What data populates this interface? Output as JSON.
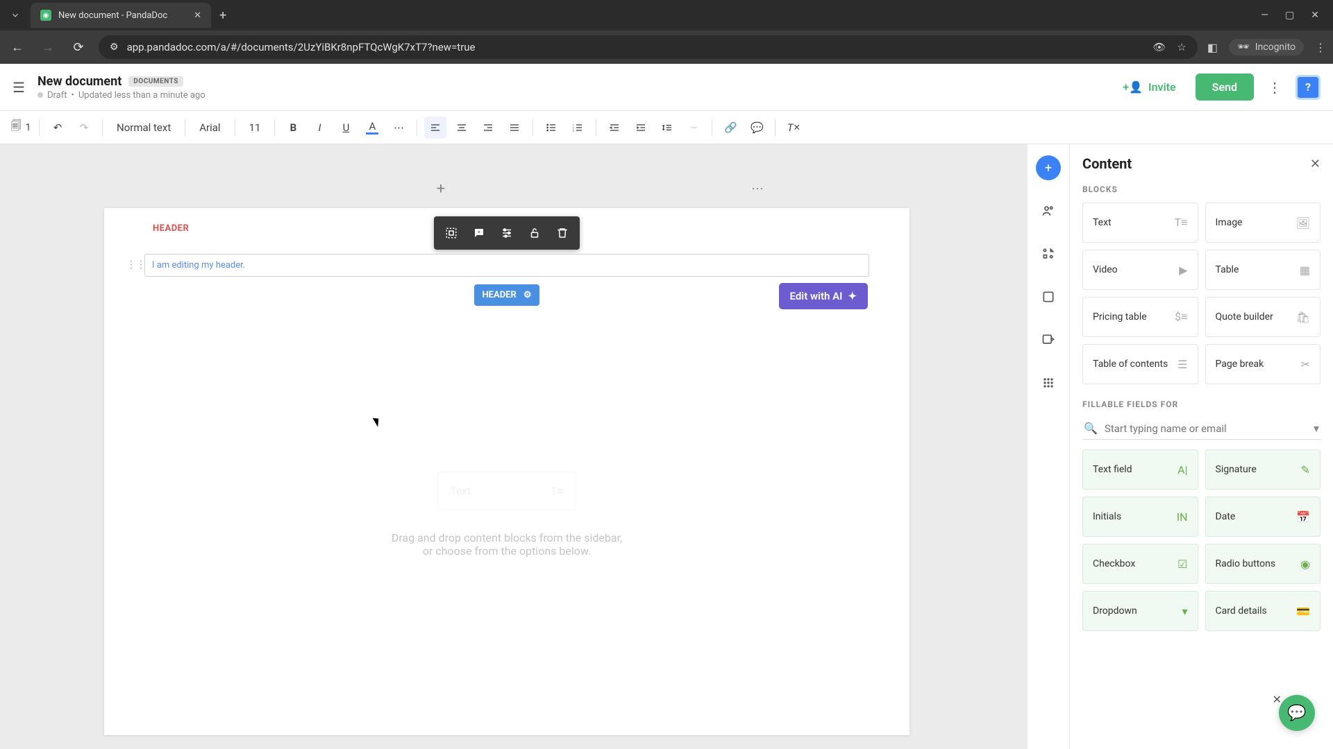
{
  "browser": {
    "tab_title": "New document - PandaDoc",
    "url": "app.pandadoc.com/a/#/documents/2UzYiBKr8npFTQcWgK7xT7?new=true",
    "incognito_label": "Incognito"
  },
  "header": {
    "title": "New document",
    "badge": "DOCUMENTS",
    "status": "Draft",
    "updated": "Updated less than a minute ago",
    "invite_label": "Invite",
    "send_label": "Send"
  },
  "toolbar": {
    "pages_count": "1",
    "style": "Normal text",
    "font": "Arial",
    "size": "11"
  },
  "canvas": {
    "header_label": "HEADER",
    "header_input_value": "I am editing my header.",
    "header_tag": "HEADER",
    "edit_ai_label": "Edit with AI",
    "ghost_text_label": "Text",
    "placeholder_line1": "Drag and drop content blocks from the sidebar,",
    "placeholder_line2": "or choose from the options below."
  },
  "panel": {
    "title": "Content",
    "blocks_label": "BLOCKS",
    "blocks": {
      "text": "Text",
      "image": "Image",
      "video": "Video",
      "table": "Table",
      "pricing_table": "Pricing table",
      "quote_builder": "Quote builder",
      "toc": "Table of contents",
      "page_break": "Page break"
    },
    "fillable_label": "FILLABLE FIELDS FOR",
    "search_placeholder": "Start typing name or email",
    "fields": {
      "text_field": "Text field",
      "signature": "Signature",
      "initials": "Initials",
      "date": "Date",
      "checkbox": "Checkbox",
      "radio": "Radio buttons",
      "dropdown": "Dropdown",
      "card": "Card details"
    }
  }
}
